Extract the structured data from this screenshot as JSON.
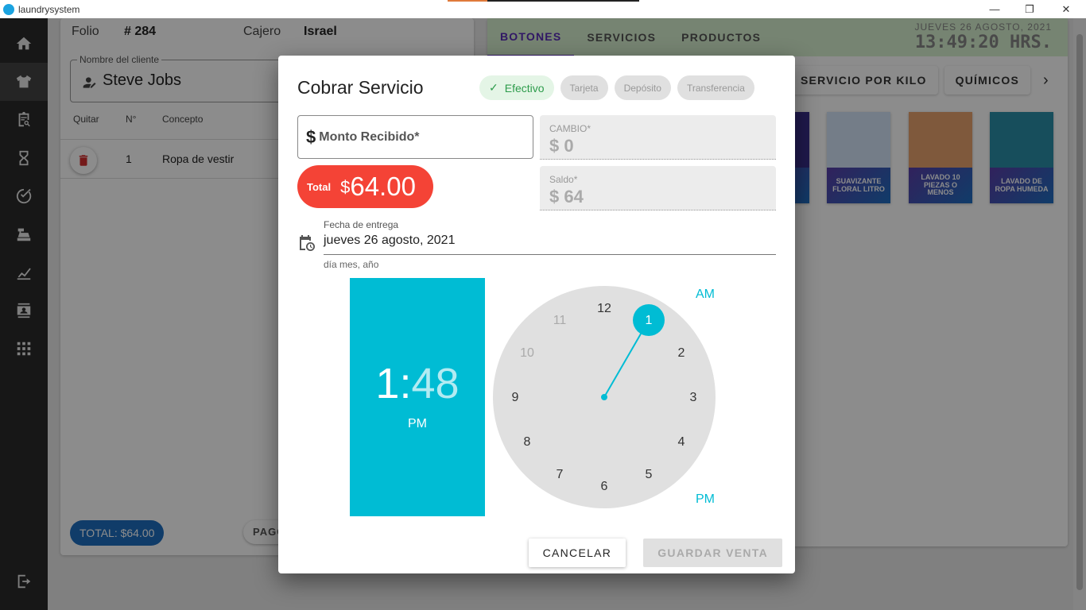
{
  "window": {
    "title": "laundrysystem",
    "minimize_glyph": "—",
    "restore_glyph": "❐",
    "close_glyph": "✕"
  },
  "sidebar": {
    "items": [
      {
        "icon": "home-icon"
      },
      {
        "icon": "shirt-icon"
      },
      {
        "icon": "clipboard-search-icon"
      },
      {
        "icon": "hourglass-icon"
      },
      {
        "icon": "check-circle-icon"
      },
      {
        "icon": "cash-register-icon"
      },
      {
        "icon": "chart-icon"
      },
      {
        "icon": "contact-card-icon"
      },
      {
        "icon": "grid-icon"
      },
      {
        "icon": "logout-icon"
      }
    ]
  },
  "ticket": {
    "folio_label": "Folio",
    "folio_value": "# 284",
    "cashier_label": "Cajero",
    "cashier_value": "Israel",
    "client_label": "Nombre del cliente",
    "client_name": "Steve Jobs",
    "columns": [
      "Quitar",
      "N°",
      "Concepto"
    ],
    "rows": [
      {
        "number": "1",
        "concept": "Ropa de vestir"
      }
    ],
    "total_label": "TOTAL: $64.00",
    "pay_button": "PAGO P"
  },
  "catalog": {
    "tabs": [
      "BOTONES",
      "SERVICIOS",
      "PRODUCTOS"
    ],
    "active_tab": "BOTONES",
    "date": "JUEVES 26 AGOSTO, 2021",
    "time": "13:49:20 HRS.",
    "categories": [
      "SERVICIO POR KILO",
      "QUÍMICOS"
    ],
    "next_glyph": "›",
    "products": [
      {
        "label": "S",
        "color": "#3a2f8a"
      },
      {
        "label": "SUAVIZANTE FLORAL LITRO",
        "color": "#d4e4f7"
      },
      {
        "label": "LAVADO 10 PIEZAS O MENOS",
        "color": "#e8a36d"
      },
      {
        "label": "LAVADO DE ROPA HUMEDA",
        "color": "#2a8fa8"
      }
    ]
  },
  "dialog": {
    "title": "Cobrar Servicio",
    "payment_methods": [
      {
        "label": "Efectivo",
        "active": true
      },
      {
        "label": "Tarjeta",
        "active": false
      },
      {
        "label": "Depósito",
        "active": false
      },
      {
        "label": "Transferencia",
        "active": false
      }
    ],
    "check_glyph": "✓",
    "amount_received_placeholder": "Monto Recibido*",
    "amount_received_prefix": "$",
    "total_label": "Total",
    "total_currency": "$",
    "total_value": "64.00",
    "change_label": "CAMBIO*",
    "change_value": "$ 0",
    "balance_label": "Saldo*",
    "balance_value": "$ 64",
    "delivery_date_label": "Fecha de entrega",
    "delivery_date_value": "jueves 26 agosto, 2021",
    "delivery_date_hint": "día mes, año",
    "time_picker": {
      "hour": "1",
      "separator": ":",
      "minute": "48",
      "period": "PM",
      "am_label": "AM",
      "pm_label": "PM",
      "selected_hour": 1,
      "hours": [
        "12",
        "1",
        "2",
        "3",
        "4",
        "5",
        "6",
        "7",
        "8",
        "9",
        "10",
        "11"
      ],
      "accent_color": "#00bcd4"
    },
    "cancel_label": "CANCELAR",
    "save_label": "GUARDAR VENTA"
  }
}
